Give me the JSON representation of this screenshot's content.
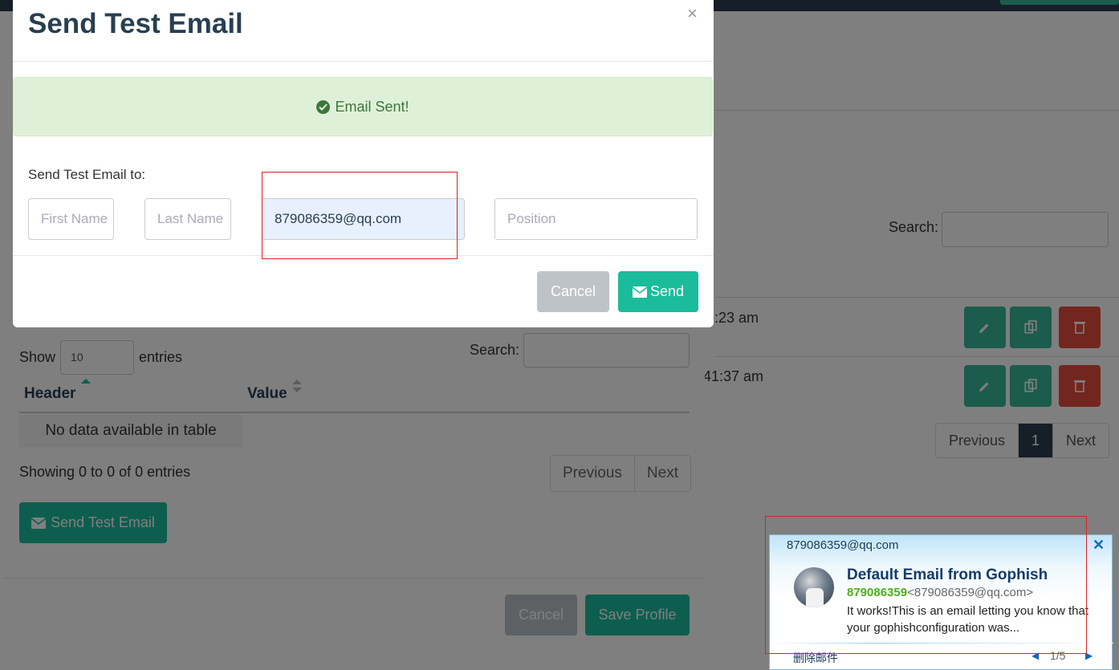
{
  "background_page": {
    "search_label": "Search:",
    "rows": [
      {
        "time_fragment": ":23 am"
      },
      {
        "time_fragment": "41:37 am"
      }
    ],
    "pagination": {
      "previous": "Previous",
      "current": "1",
      "next": "Next"
    }
  },
  "profile_modal": {
    "show_label": "Show",
    "entries_value": "10",
    "entries_label": "entries",
    "search_label": "Search:",
    "table_headers": [
      "Header",
      "Value"
    ],
    "empty_text": "No data available in table",
    "showing_text": "Showing 0 to 0 of 0 entries",
    "pagination": {
      "previous": "Previous",
      "next": "Next"
    },
    "send_test_label": "Send Test Email",
    "cancel_label": "Cancel",
    "save_label": "Save Profile"
  },
  "test_modal": {
    "title": "Send Test Email",
    "close_symbol": "×",
    "alert_text": "Email Sent!",
    "send_to_label": "Send Test Email to:",
    "first_name_placeholder": "First Name",
    "last_name_placeholder": "Last Name",
    "email_value": "879086359@qq.com",
    "position_placeholder": "Position",
    "cancel_label": "Cancel",
    "send_label": "Send"
  },
  "notification": {
    "account": "879086359@qq.com",
    "close_symbol": "✕",
    "subject": "Default Email from Gophish",
    "sender_name": "879086359",
    "sender_address": "<879086359@qq.com>",
    "body": "It works!This is an email letting you know that your gophishconfiguration was...",
    "delete_label": "删除邮件",
    "page_indicator": "1/5"
  },
  "colors": {
    "primary": "#1abc9c",
    "danger": "#e74c3c",
    "dark": "#2c3e50",
    "success_alert_bg": "#dff0d8",
    "annotation_red": "#e02020"
  }
}
